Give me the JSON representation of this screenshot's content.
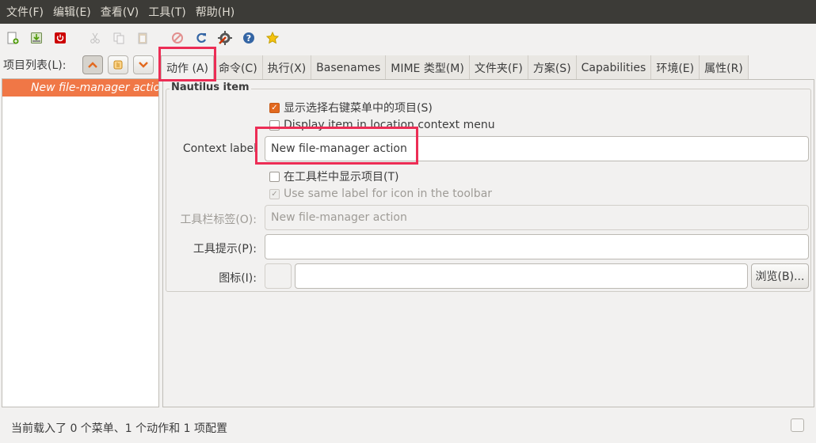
{
  "menubar": {
    "items": [
      "文件(F)",
      "编辑(E)",
      "查看(V)",
      "工具(T)",
      "帮助(H)"
    ]
  },
  "toolbar": {
    "icons": [
      "new-file-icon",
      "save-icon",
      "quit-icon",
      "cut-icon",
      "copy-icon",
      "paste-icon",
      "delete-icon",
      "reload-icon",
      "preferences-icon",
      "help-icon",
      "about-icon"
    ]
  },
  "list": {
    "label": "项目列表(L):",
    "items": [
      "New file-manager action"
    ]
  },
  "tabs": [
    "动作 (A)",
    "命令(C)",
    "执行(X)",
    "Basenames",
    "MIME 类型(M)",
    "文件夹(F)",
    "方案(S)",
    "Capabilities",
    "环境(E)",
    "属性(R)"
  ],
  "nautilus": {
    "title": "Nautilus item",
    "show_in_selection_menu": "显示选择右键菜单中的项目(S)",
    "show_in_location_menu": "Display item in location context menu",
    "context_label": "Context label",
    "context_value": "New file-manager action",
    "show_in_toolbar": "在工具栏中显示项目(T)",
    "same_label": "Use same label for icon in the toolbar",
    "toolbar_label": "工具栏标签(O):",
    "toolbar_value": "New file-manager action",
    "tooltip_label": "工具提示(P):",
    "tooltip_value": "",
    "icon_label": "图标(I):",
    "icon_value": "",
    "browse_button": "浏览(B)..."
  },
  "status": {
    "text": "当前载入了 0 个菜单、1 个动作和 1 项配置"
  },
  "colors": {
    "accent": "#f07746",
    "highlight": "#ec2d55",
    "menubar": "#3c3b37"
  }
}
